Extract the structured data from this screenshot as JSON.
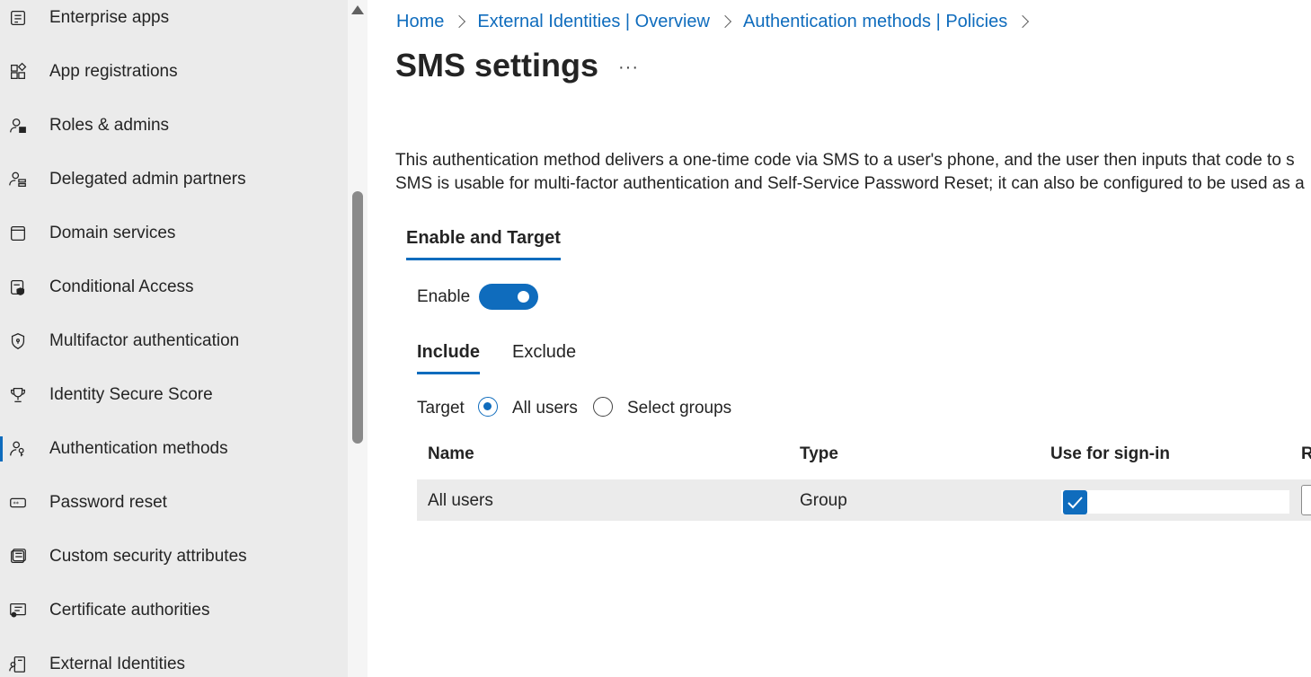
{
  "sidebar": {
    "items": [
      {
        "label": "Enterprise apps",
        "icon": "enterprise-apps-icon"
      },
      {
        "label": "App registrations",
        "icon": "app-registrations-icon"
      },
      {
        "label": "Roles & admins",
        "icon": "roles-admins-icon"
      },
      {
        "label": "Delegated admin partners",
        "icon": "delegated-admin-icon"
      },
      {
        "label": "Domain services",
        "icon": "domain-services-icon"
      },
      {
        "label": "Conditional Access",
        "icon": "conditional-access-icon"
      },
      {
        "label": "Multifactor authentication",
        "icon": "shield-icon"
      },
      {
        "label": "Identity Secure Score",
        "icon": "trophy-icon"
      },
      {
        "label": "Authentication methods",
        "icon": "key-person-icon",
        "active": true
      },
      {
        "label": "Password reset",
        "icon": "password-icon"
      },
      {
        "label": "Custom security attributes",
        "icon": "attributes-icon"
      },
      {
        "label": "Certificate authorities",
        "icon": "certificate-icon"
      },
      {
        "label": "External Identities",
        "icon": "external-identities-icon"
      }
    ]
  },
  "breadcrumb": [
    "Home",
    "External Identities | Overview",
    "Authentication methods | Policies"
  ],
  "page": {
    "title": "SMS settings",
    "more": "···",
    "description_line1": "This authentication method delivers a one-time code via SMS to a user's phone, and the user then inputs that code to s",
    "description_line2": "SMS is usable for multi-factor authentication and Self-Service Password Reset; it can also be configured to be used as a"
  },
  "tabs": {
    "main": "Enable and Target"
  },
  "enable": {
    "label": "Enable",
    "on": true
  },
  "subtabs": {
    "include": "Include",
    "exclude": "Exclude"
  },
  "target": {
    "label": "Target",
    "all_users": "All users",
    "select_groups": "Select groups",
    "selected": "all_users"
  },
  "table": {
    "headers": {
      "name": "Name",
      "type": "Type",
      "use_for_signin": "Use for sign-in",
      "partial": "R"
    },
    "rows": [
      {
        "name": "All users",
        "type": "Group",
        "use_for_signin": true
      }
    ]
  },
  "colors": {
    "accent": "#0f6cbd",
    "sidebar_bg": "#ebebeb",
    "row_bg": "#ebebeb"
  }
}
